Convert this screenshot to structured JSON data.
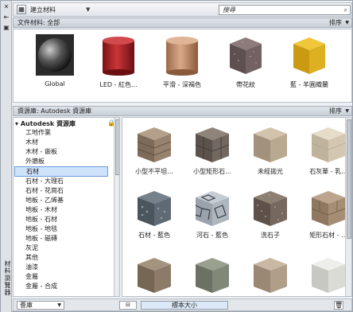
{
  "toolbar": {
    "new_material_label": "建立材料"
  },
  "search": {
    "placeholder": "搜尋"
  },
  "doc_section": {
    "title": "文件材料: 全部",
    "sort_label": "排序"
  },
  "doc_materials": [
    {
      "label": "Global"
    },
    {
      "label": "LED - 紅色..."
    },
    {
      "label": "平滑 - 深褐色"
    },
    {
      "label": "帶花紋"
    },
    {
      "label": "藍 - 羊圓織蘭"
    }
  ],
  "library_section": {
    "title": "資源庫: Autodesk 資源庫",
    "sort_label": "排序"
  },
  "tree": {
    "root": "Autodesk 資源庫",
    "items": [
      "工地作業",
      "木材",
      "木材 - 嵌板",
      "外牆板",
      "石材",
      "石材 - 大理石",
      "石材 - 花崗石",
      "地板 - 乙烯基",
      "地板 - 木材",
      "地板 - 石材",
      "地板 - 地毯",
      "地板 - 磁磚",
      "灰泥",
      "其他",
      "油漆",
      "金屬",
      "金屬 - 合成"
    ],
    "selected_index": 4
  },
  "grid_items": [
    {
      "label": "小型不平坦..."
    },
    {
      "label": "小型矩形石..."
    },
    {
      "label": "未經拋光"
    },
    {
      "label": "石灰華 - 乳..."
    },
    {
      "label": "石材 - 藍色"
    },
    {
      "label": "河石 - 藍色"
    },
    {
      "label": "洗石子"
    },
    {
      "label": "矩形石材 - ..."
    },
    {
      "label": ""
    },
    {
      "label": ""
    },
    {
      "label": ""
    },
    {
      "label": ""
    }
  ],
  "bottombar": {
    "library_dropdown": "薈庫",
    "view_label": "⊟",
    "size_label": "標本大小"
  },
  "palette_title": "材料瀏覽器",
  "colors": {
    "selection_bg": "#cfe3fb",
    "selection_border": "#6b9bd8"
  }
}
